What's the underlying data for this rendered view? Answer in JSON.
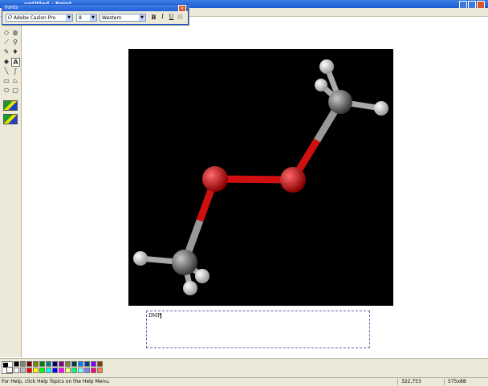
{
  "window": {
    "title": "untitled - Paint"
  },
  "fonts_toolbar": {
    "title": "Fonts",
    "font_name": "Adobe Caslon Pro",
    "font_size": "8",
    "script": "Western",
    "bold_label": "B",
    "italic_label": "I",
    "underline_label": "U"
  },
  "text_box": {
    "content": "DMP"
  },
  "status": {
    "help": "For Help, click Help Topics on the Help Menu.",
    "coords": "322,753",
    "size": "575x88"
  },
  "palette": {
    "colors": [
      "#000000",
      "#808080",
      "#800000",
      "#808000",
      "#008000",
      "#008080",
      "#000080",
      "#800080",
      "#808040",
      "#004040",
      "#0080ff",
      "#004080",
      "#8000ff",
      "#804000",
      "#ffffff",
      "#c0c0c0",
      "#ff0000",
      "#ffff00",
      "#00ff00",
      "#00ffff",
      "#0000ff",
      "#ff00ff",
      "#ffff80",
      "#00ff80",
      "#80ffff",
      "#8080ff",
      "#ff0080",
      "#ff8040"
    ]
  },
  "icons": [
    "free-select-icon",
    "select-icon",
    "eraser-icon",
    "fill-icon",
    "pick-color-icon",
    "magnifier-icon",
    "pencil-icon",
    "brush-icon",
    "airbrush-icon",
    "text-icon",
    "line-icon",
    "curve-icon",
    "rectangle-icon",
    "polygon-icon",
    "ellipse-icon",
    "rounded-rectangle-icon"
  ]
}
